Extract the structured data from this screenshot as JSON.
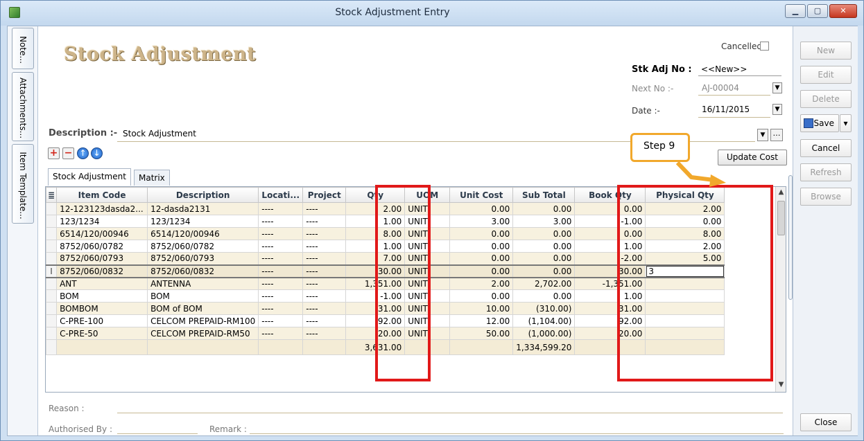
{
  "window": {
    "title": "Stock Adjustment Entry"
  },
  "side_tabs": [
    "Note...",
    "Attachments...",
    "Item Template..."
  ],
  "header": {
    "heading": "Stock Adjustment",
    "cancelled_label": "Cancelled",
    "stk_adj_no_label": "Stk Adj No :",
    "stk_adj_no_value": "<<New>>",
    "next_no_label": "Next No :-",
    "next_no_value": "AJ-00004",
    "date_label": "Date :-",
    "date_value": "16/11/2015"
  },
  "description": {
    "label": "Description :-",
    "value": "Stock Adjustment"
  },
  "toolbar": {
    "update_cost_label": "Update Cost"
  },
  "tabs": [
    "Stock Adjustment",
    "Matrix"
  ],
  "callout": {
    "text": "Step 9"
  },
  "grid": {
    "columns": [
      "Item Code",
      "Description",
      "Locati...",
      "Project",
      "Qty",
      "UOM",
      "Unit Cost",
      "Sub Total",
      "Book Qty",
      "Physical Qty"
    ],
    "rows": [
      [
        "12-123123dasda2...",
        "12-dasda2131",
        "----",
        "----",
        "2.00",
        "UNIT",
        "0.00",
        "0.00",
        "0.00",
        "2.00"
      ],
      [
        "123/1234",
        "123/1234",
        "----",
        "----",
        "1.00",
        "UNIT",
        "3.00",
        "3.00",
        "-1.00",
        "0.00"
      ],
      [
        "6514/120/00946",
        "6514/120/00946",
        "----",
        "----",
        "8.00",
        "UNIT",
        "0.00",
        "0.00",
        "0.00",
        "8.00"
      ],
      [
        "8752/060/0782",
        "8752/060/0782",
        "----",
        "----",
        "1.00",
        "UNIT",
        "0.00",
        "0.00",
        "1.00",
        "2.00"
      ],
      [
        "8752/060/0793",
        "8752/060/0793",
        "----",
        "----",
        "7.00",
        "UNIT",
        "0.00",
        "0.00",
        "-2.00",
        "5.00"
      ],
      [
        "8752/060/0832",
        "8752/060/0832",
        "----",
        "----",
        "-30.00",
        "UNIT",
        "0.00",
        "0.00",
        "30.00",
        "3"
      ],
      [
        "ANT",
        "ANTENNA",
        "----",
        "----",
        "1,351.00",
        "UNIT",
        "2.00",
        "2,702.00",
        "-1,351.00",
        ""
      ],
      [
        "BOM",
        "BOM",
        "----",
        "----",
        "-1.00",
        "UNIT",
        "0.00",
        "0.00",
        "1.00",
        ""
      ],
      [
        "BOMBOM",
        "BOM of BOM",
        "----",
        "----",
        "-31.00",
        "UNIT",
        "10.00",
        "(310.00)",
        "31.00",
        ""
      ],
      [
        "C-PRE-100",
        "CELCOM PREPAID-RM100",
        "----",
        "----",
        "-92.00",
        "UNIT",
        "12.00",
        "(1,104.00)",
        "92.00",
        ""
      ],
      [
        "C-PRE-50",
        "CELCOM PREPAID-RM50",
        "----",
        "----",
        "-20.00",
        "UNIT",
        "50.00",
        "(1,000.00)",
        "20.00",
        ""
      ]
    ],
    "selected_row": 5,
    "totals": {
      "qty": "3,631.00",
      "sub_total": "1,334,599.20"
    }
  },
  "footer": {
    "reason_label": "Reason :",
    "authorised_label": "Authorised By :",
    "remark_label": "Remark :"
  },
  "actions": {
    "new": "New",
    "edit": "Edit",
    "delete": "Delete",
    "save": "Save",
    "cancel": "Cancel",
    "refresh": "Refresh",
    "browse": "Browse",
    "close": "Close"
  },
  "colors": {
    "highlight": "#e11919",
    "callout_border": "#f1a82c",
    "heading": "#cdb489"
  }
}
